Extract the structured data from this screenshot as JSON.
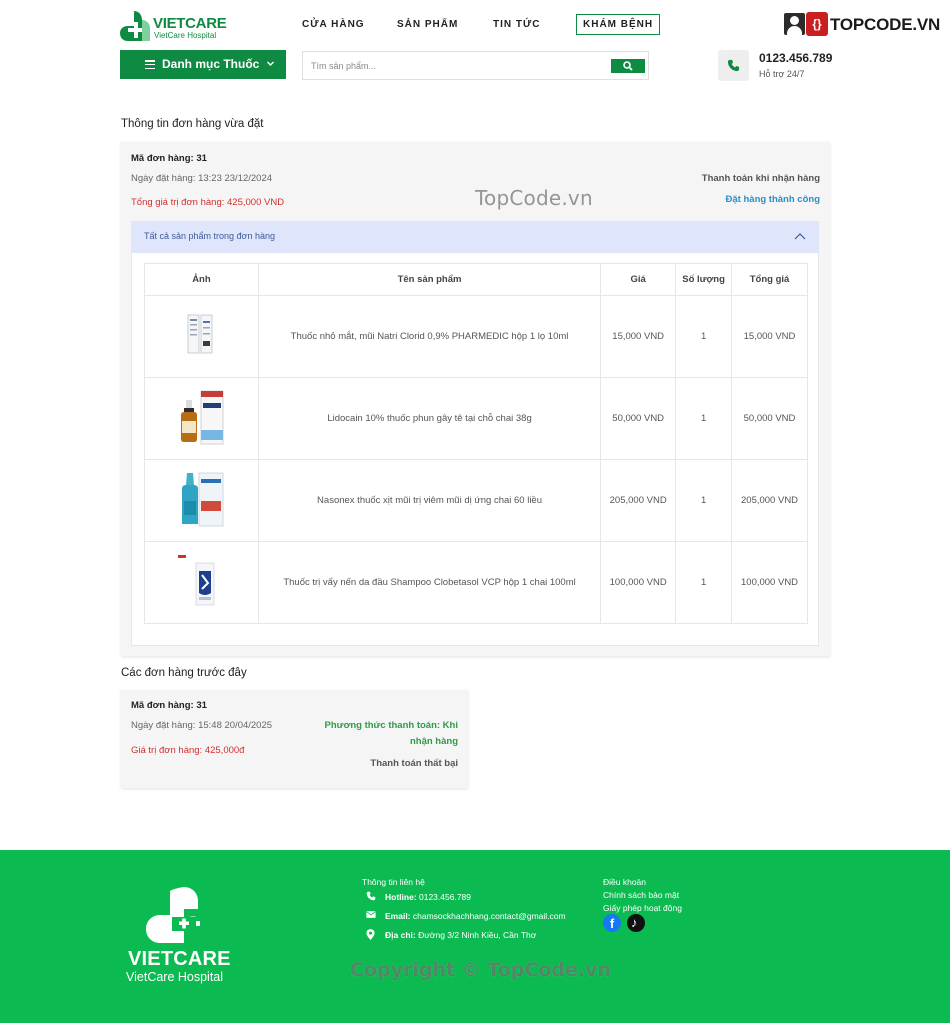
{
  "header": {
    "logo_text": "VIETCARE",
    "logo_sub": "VietCare Hospital",
    "nav": [
      "CỬA HÀNG",
      "SẢN PHẨM",
      "TIN TỨC",
      "KHÁM BỆNH"
    ],
    "watermark_logo": "TOPCODE.VN",
    "category_button": "Danh mục Thuốc",
    "search_placeholder": "Tìm sản phẩm...",
    "hotline_number": "0123.456.789",
    "hotline_sub": "Hỗ trợ 24/7"
  },
  "recent_order": {
    "section_title": "Thông tin đơn hàng vừa đặt",
    "code": "Mã đơn hàng: 31",
    "date": "Ngày đặt hàng: 13:23 23/12/2024",
    "total": "Tổng giá trị đơn hàng: 425,000 VND",
    "payment": "Thanh toán khi nhận hàng",
    "status": "Đặt hàng thành công",
    "watermark": "TopCode.vn",
    "accordion_label": "Tất cả sản phẩm trong đơn hàng",
    "table_headers": [
      "Ảnh",
      "Tên sản phẩm",
      "Giá",
      "Số lượng",
      "Tổng giá"
    ],
    "items": [
      {
        "name": "Thuốc nhỏ mắt, mũi Natri Clorid 0,9% PHARMEDIC hộp 1 lọ 10ml",
        "price": "15,000 VND",
        "qty": "1",
        "total": "15,000 VND"
      },
      {
        "name": "Lidocain 10% thuốc phun gây tê tại chỗ chai 38g",
        "price": "50,000 VND",
        "qty": "1",
        "total": "50,000 VND"
      },
      {
        "name": "Nasonex thuốc xịt mũi trị viêm mũi dị ứng chai 60 liều",
        "price": "205,000 VND",
        "qty": "1",
        "total": "205,000 VND"
      },
      {
        "name": "Thuốc trị vẩy nến da đầu Shampoo Clobetasol VCP hộp 1 chai 100ml",
        "price": "100,000 VND",
        "qty": "1",
        "total": "100,000 VND"
      }
    ]
  },
  "previous_orders": {
    "section_title": "Các đơn hàng trước đây",
    "orders": [
      {
        "code": "Mã đơn hàng: 31",
        "date": "Ngày đặt hàng: 15:48 20/04/2025",
        "total": "Giá trị đơn hàng: 425,000đ",
        "method": "Phương thức thanh toán: Khi nhận hàng",
        "status": "Thanh toán thất bại"
      }
    ]
  },
  "footer": {
    "logo_text": "VIETCARE",
    "logo_sub": "VietCare Hospital",
    "contact_title": "Thông tin liên hệ",
    "hotline_label": "Hotline:",
    "hotline_value": " 0123.456.789",
    "email_label": "Email:",
    "email_value": " chamsockhachhang.contact@gmail.com",
    "address_label": "Địa chỉ:",
    "address_value": " Đường 3/2 Ninh Kiều, Cần Thơ",
    "links": [
      "Điều khoản",
      "Chính sách bảo mật",
      "Giấy phép hoạt động"
    ],
    "copyright": "Copyright © TopCode.vn"
  },
  "colors": {
    "brand_green": "#0f8a43",
    "footer_green": "#0bbb51",
    "danger_red": "#d32f2f",
    "status_blue": "#2a8fc6",
    "accordion_bg": "#dfe6fb"
  },
  "icons": [
    "cross-logo-icon",
    "menu-icon",
    "chevron-down-icon",
    "search-icon",
    "phone-icon",
    "chevron-up-icon",
    "mail-icon",
    "location-icon",
    "facebook-icon",
    "tiktok-icon"
  ]
}
